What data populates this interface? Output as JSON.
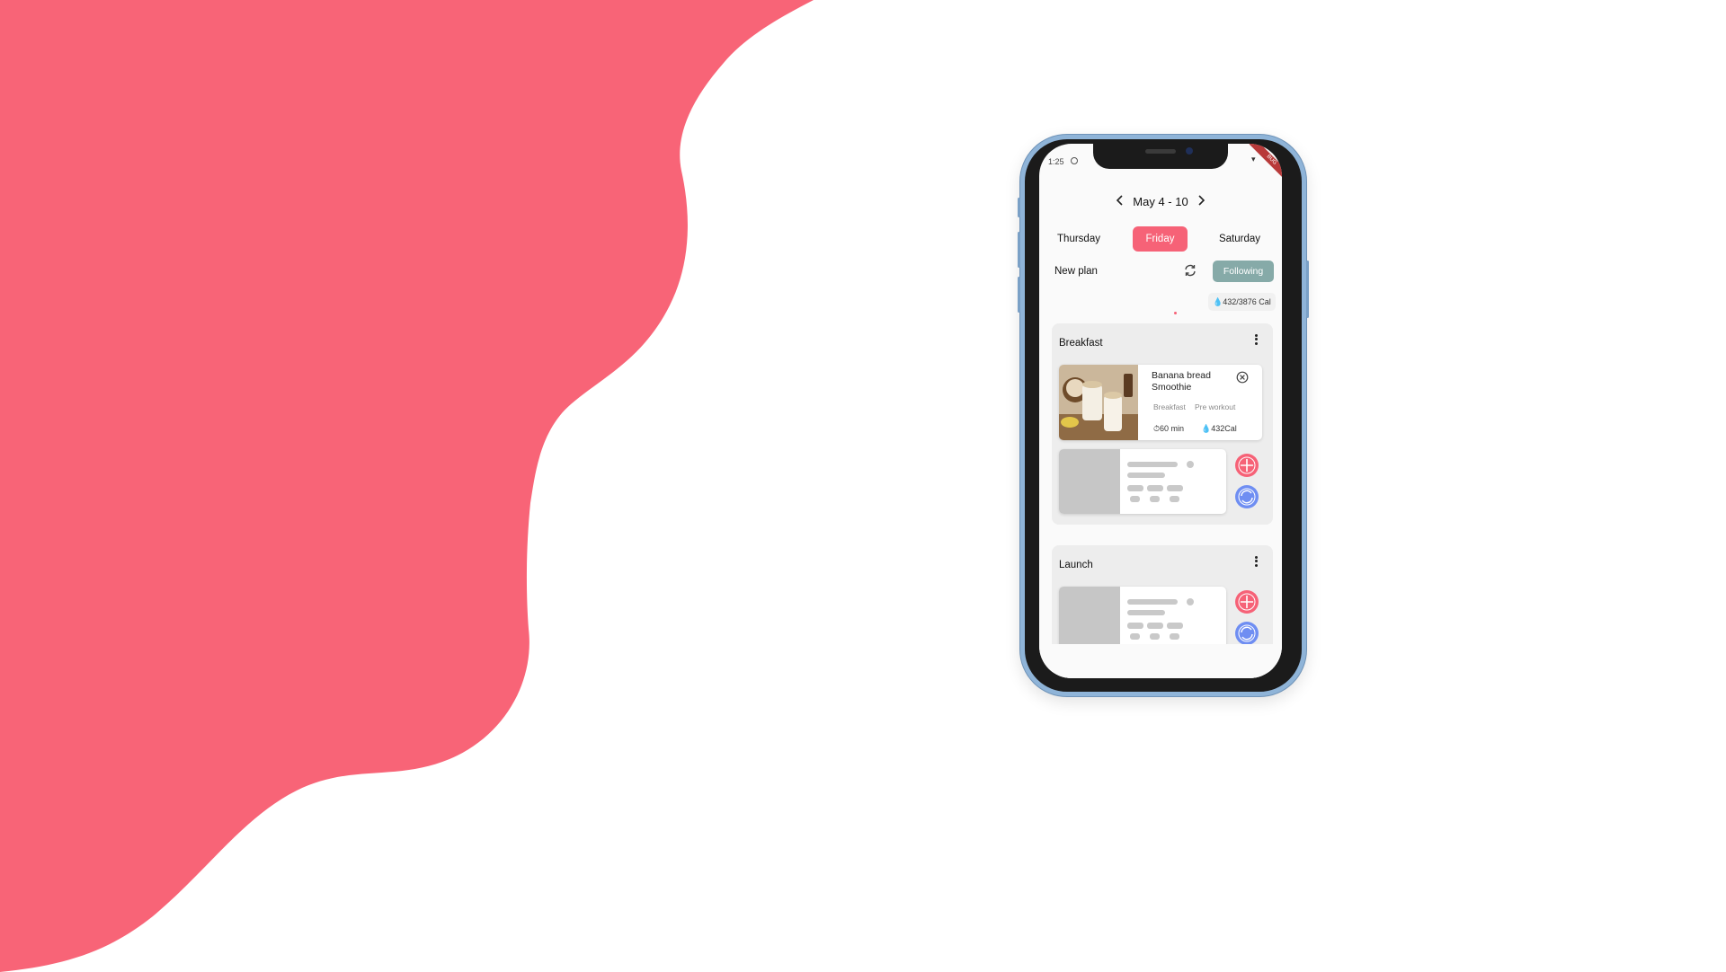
{
  "status_bar": {
    "time": "1:25",
    "debug_label": "BUG"
  },
  "week": {
    "range": "May 4 - 10",
    "prev_icon": "chevron-left-icon",
    "next_icon": "chevron-right-icon"
  },
  "days": [
    {
      "label": "Thursday",
      "active": false
    },
    {
      "label": "Friday",
      "active": true
    },
    {
      "label": "Saturday",
      "active": false
    }
  ],
  "plan": {
    "label": "New plan",
    "sync_icon": "sync-icon",
    "following_label": "Following",
    "calories": "432/3876 Cal"
  },
  "meals": [
    {
      "title": "Breakfast",
      "recipe": {
        "name": "Banana bread Smoothie",
        "tags": [
          "Breakfast",
          "Pre workout"
        ],
        "time": "60 min",
        "calories": "432Cal"
      }
    },
    {
      "title": "Launch"
    }
  ],
  "colors": {
    "accent": "#f66277",
    "following": "#86aaa8",
    "swap": "#6f8ef2",
    "phone_frame": "#8fb4d8"
  }
}
